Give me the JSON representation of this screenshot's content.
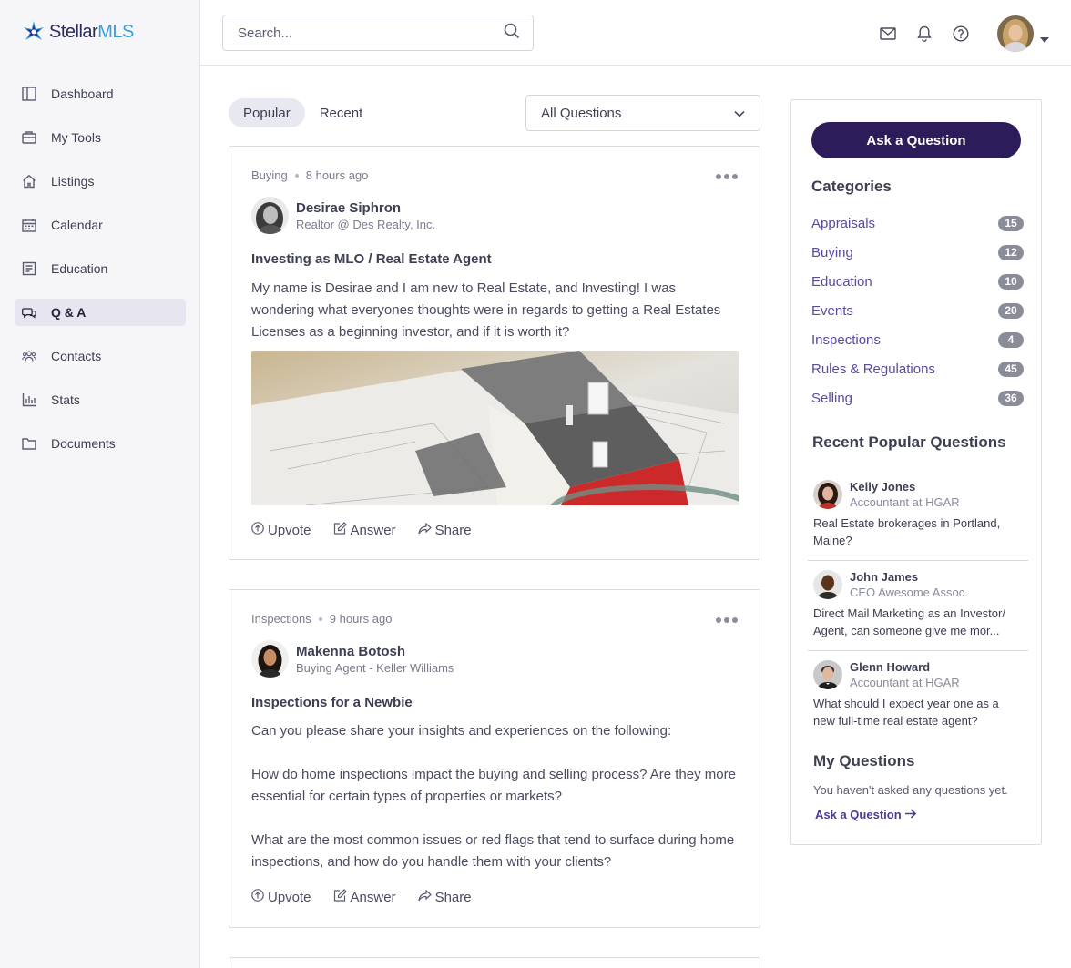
{
  "brand": {
    "name_part1": "Stellar",
    "name_part2": "MLS"
  },
  "sidebar": {
    "items": [
      {
        "label": "Dashboard",
        "icon": "dashboard-icon"
      },
      {
        "label": "My Tools",
        "icon": "toolbox-icon"
      },
      {
        "label": "Listings",
        "icon": "home-icon"
      },
      {
        "label": "Calendar",
        "icon": "calendar-icon"
      },
      {
        "label": "Education",
        "icon": "book-icon"
      },
      {
        "label": "Q & A",
        "icon": "chat-icon",
        "active": true
      },
      {
        "label": "Contacts",
        "icon": "people-icon"
      },
      {
        "label": "Stats",
        "icon": "bar-chart-icon"
      },
      {
        "label": "Documents",
        "icon": "folder-icon"
      }
    ]
  },
  "header": {
    "search_placeholder": "Search..."
  },
  "feed": {
    "tabs": [
      {
        "label": "Popular",
        "active": true
      },
      {
        "label": "Recent"
      }
    ],
    "filter": {
      "selected": "All Questions"
    },
    "posts": [
      {
        "category": "Buying",
        "time": "8 hours ago",
        "author": "Desirae Siphron",
        "role": "Realtor @ Des Realty, Inc.",
        "title": "Investing as MLO / Real Estate Agent",
        "body": "My name is Desirae and I am new to Real Estate, and Investing!  I was wondering what everyones thoughts were in regards to getting a Real Estates Licenses as a beginning investor, and if it is worth it?"
      },
      {
        "category": "Inspections",
        "time": "9 hours ago",
        "author": "Makenna Botosh",
        "role": "Buying Agent - Keller Williams",
        "title": "Inspections for a Newbie",
        "body": "Can you please share your insights and experiences on the following:\n\nHow do home inspections impact the buying and selling process? Are they more essential for certain types of properties or markets?\n\nWhat are the most common issues or red flags that tend to surface during home inspections, and how do you handle them with your clients?"
      }
    ],
    "actions": {
      "upvote": "Upvote",
      "answer": "Answer",
      "share": "Share"
    }
  },
  "right_panel": {
    "ask_button": "Ask a Question",
    "categories_title": "Categories",
    "categories": [
      {
        "name": "Appraisals",
        "count": "15"
      },
      {
        "name": "Buying",
        "count": "12"
      },
      {
        "name": "Education",
        "count": "10"
      },
      {
        "name": "Events",
        "count": "20"
      },
      {
        "name": "Inspections",
        "count": "4"
      },
      {
        "name": "Rules & Regulations",
        "count": "45"
      },
      {
        "name": "Selling",
        "count": "36"
      }
    ],
    "recent_title": "Recent Popular Questions",
    "recent": [
      {
        "name": "Kelly Jones",
        "role": "Accountant at HGAR",
        "question": "Real Estate brokerages in Portland, Maine?"
      },
      {
        "name": "John James",
        "role": "CEO Awesome Assoc.",
        "question": "Direct Mail Marketing as an Investor/ Agent, can someone give me mor..."
      },
      {
        "name": "Glenn Howard",
        "role": "Accountant at HGAR",
        "question": "What should I expect year one as a new full-time real estate agent?"
      }
    ],
    "my_questions_title": "My Questions",
    "my_questions_empty": "You haven't asked any questions yet.",
    "my_questions_link": "Ask a Question"
  },
  "colors": {
    "accent": "#2c1d5a",
    "link": "#5b4aa0",
    "badge": "#8b8c99"
  }
}
